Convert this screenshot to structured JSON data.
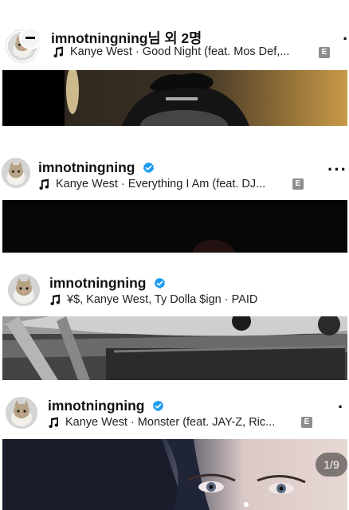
{
  "posts": [
    {
      "username": "imnotningning",
      "username_suffix": "님 외 2명",
      "verified": false,
      "song": "Kanye West · Good Night (feat. Mos Def,...",
      "explicit": "E"
    },
    {
      "username": "imnotningning",
      "username_suffix": "",
      "verified": true,
      "song": "Kanye West · Everything I Am (feat. DJ...",
      "explicit": "E"
    },
    {
      "username": "imnotningning",
      "username_suffix": "",
      "verified": true,
      "song": "¥$, Kanye West, Ty Dolla $ign · PAID",
      "explicit": ""
    },
    {
      "username": "imnotningning",
      "username_suffix": "",
      "verified": true,
      "song": "Kanye West · Monster (feat. JAY-Z, Ric...",
      "explicit": "E"
    }
  ],
  "carousel": {
    "counter": "1/9"
  },
  "colors": {
    "verified": "#1d9bf0",
    "explicit_bg": "#8e8e8e"
  },
  "icons": [
    "music-note-icon",
    "verified-badge-icon",
    "more-options-icon",
    "explicit-badge-icon"
  ]
}
